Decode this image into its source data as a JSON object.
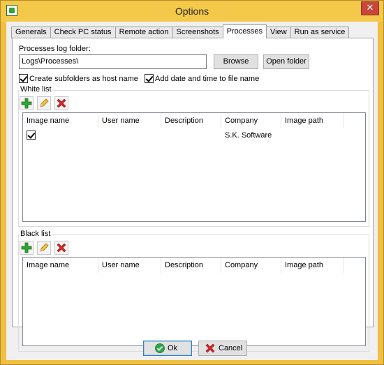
{
  "window": {
    "title": "Options",
    "close_glyph": "✕"
  },
  "tabs": [
    {
      "label": "Generals"
    },
    {
      "label": "Check PC status"
    },
    {
      "label": "Remote action"
    },
    {
      "label": "Screenshots"
    },
    {
      "label": "Processes",
      "active": true
    },
    {
      "label": "View"
    },
    {
      "label": "Run as service"
    }
  ],
  "processes": {
    "log_folder_label": "Processes log folder:",
    "log_folder_value": "Logs\\Processes\\",
    "browse_label": "Browse",
    "open_folder_label": "Open folder",
    "create_subfolders_label": "Create subfolders as host name",
    "create_subfolders_checked": true,
    "add_date_label": "Add date and time to file name",
    "add_date_checked": true
  },
  "white_list": {
    "title": "White list",
    "columns": [
      "Image name",
      "User name",
      "Description",
      "Company",
      "Image path"
    ],
    "rows": [
      {
        "checked": true,
        "image_name": "",
        "user_name": "",
        "description": "",
        "company": "S.K. Software",
        "image_path": ""
      }
    ]
  },
  "black_list": {
    "title": "Black list",
    "columns": [
      "Image name",
      "User name",
      "Description",
      "Company",
      "Image path"
    ],
    "rows": []
  },
  "footer": {
    "ok_label": "Ok",
    "cancel_label": "Cancel"
  },
  "icons": {
    "add": "plus-icon",
    "edit": "pencil-icon",
    "delete": "delete-x-icon",
    "ok": "ok-check-icon",
    "cancel": "cancel-x-icon"
  },
  "colors": {
    "title_bar": "#f4c94a",
    "close_button": "#c7473a",
    "add_icon": "#2fa52f",
    "delete_icon": "#d22a2a"
  }
}
